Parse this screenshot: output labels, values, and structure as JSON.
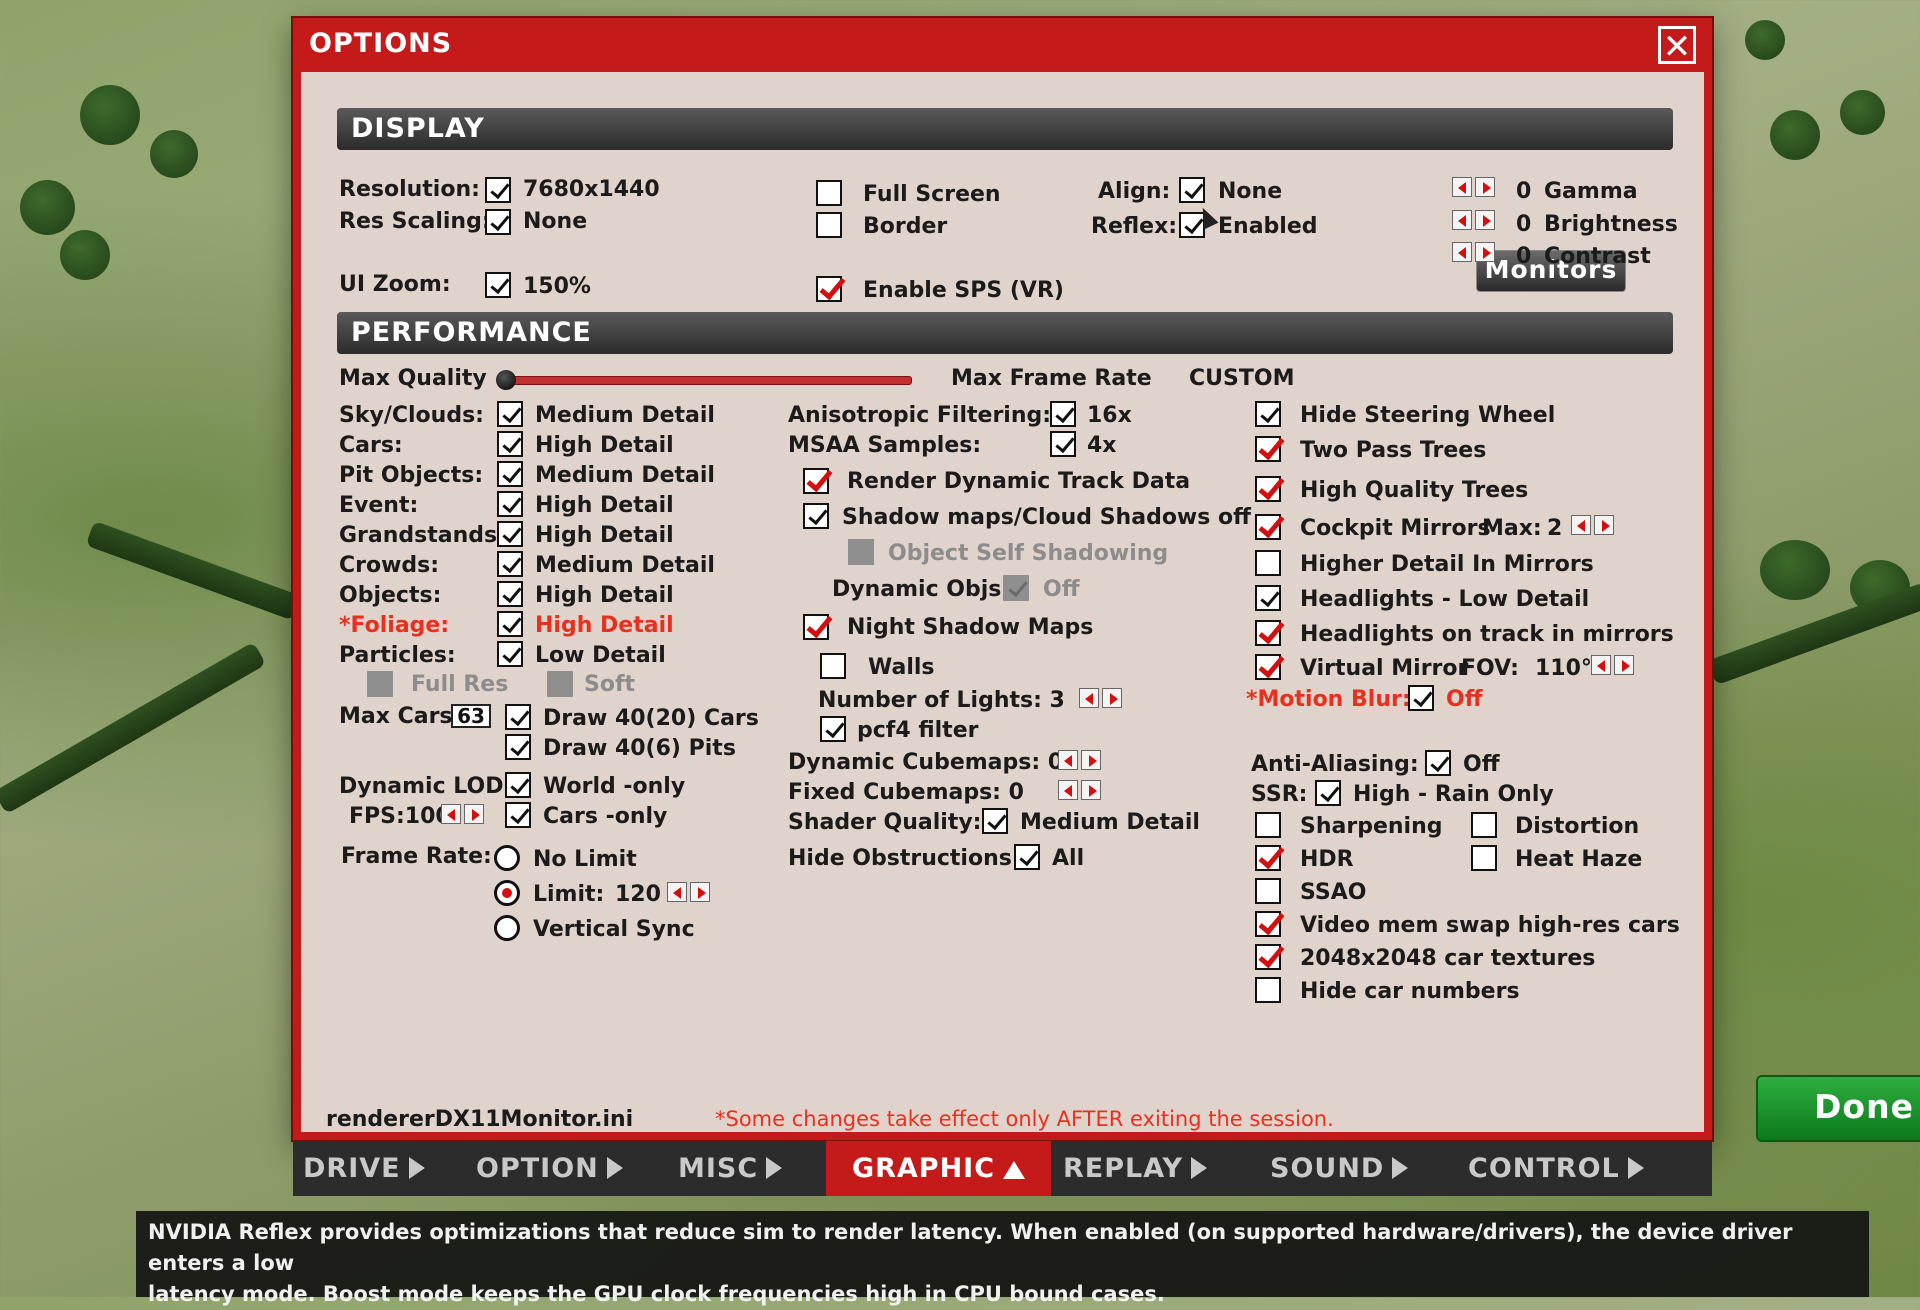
{
  "window": {
    "title": "OPTIONS",
    "close_icon": "close-icon"
  },
  "display": {
    "section_title": "DISPLAY",
    "resolution_label": "Resolution:",
    "resolution_value": "7680x1440",
    "res_scaling_label": "Res Scaling:",
    "res_scaling_value": "None",
    "ui_zoom_label": "UI Zoom:",
    "ui_zoom_value": "150%",
    "full_screen_label": "Full Screen",
    "full_screen": false,
    "border_label": "Border",
    "border": false,
    "sps_label": "Enable SPS (VR)",
    "sps": true,
    "align_label": "Align:",
    "align_value": "None",
    "reflex_label": "Reflex:",
    "reflex_value": "Enabled",
    "monitors_label": "Monitors",
    "gamma_value": "0",
    "gamma_label": "Gamma",
    "brightness_value": "0",
    "brightness_label": "Brightness",
    "contrast_value": "0",
    "contrast_label": "Contrast"
  },
  "performance": {
    "section_title": "PERFORMANCE",
    "max_quality_label": "Max Quality",
    "max_quality_level": 0.0,
    "max_frame_rate_label": "Max Frame Rate",
    "custom_label": "CUSTOM",
    "detail_rows": [
      {
        "label": "Sky/Clouds:",
        "value": "Medium Detail"
      },
      {
        "label": "Cars:",
        "value": "High Detail"
      },
      {
        "label": "Pit Objects:",
        "value": "Medium Detail"
      },
      {
        "label": "Event:",
        "value": "High Detail"
      },
      {
        "label": "Grandstands:",
        "value": "High Detail"
      },
      {
        "label": "Crowds:",
        "value": "Medium Detail"
      },
      {
        "label": "Objects:",
        "value": "High Detail"
      },
      {
        "label": "*Foliage:",
        "value": "High Detail"
      },
      {
        "label": "Particles:",
        "value": "Low Detail"
      }
    ],
    "full_res_label": "Full Res",
    "soft_label": "Soft",
    "max_cars_label": "Max Cars:",
    "max_cars_value": "63",
    "draw_cars_label": "Draw 40(20) Cars",
    "draw_pits_label": "Draw 40(6) Pits",
    "dynamic_lod_label": "Dynamic LOD",
    "fps_label": "FPS:100",
    "world_only_label": "World -only",
    "cars_only_label": "Cars -only",
    "frame_rate_label": "Frame Rate:",
    "no_limit_label": "No Limit",
    "limit_label": "Limit:",
    "limit_value": "120",
    "vsync_label": "Vertical Sync",
    "aniso_label": "Anisotropic Filtering:",
    "aniso_value": "16x",
    "msaa_label": "MSAA Samples:",
    "msaa_value": "4x",
    "render_dynamic_label": "Render Dynamic Track Data",
    "shadow_maps_label": "Shadow maps/Cloud Shadows off",
    "self_shadow_label": "Object Self Shadowing",
    "dynamic_objs_label": "Dynamic Objs:",
    "dynamic_objs_value": "Off",
    "night_shadow_label": "Night Shadow Maps",
    "walls_label": "Walls",
    "num_lights_label": "Number of Lights: 3",
    "pcf4_label": "pcf4 filter",
    "dyn_cubemaps_label": "Dynamic Cubemaps: 0",
    "fixed_cubemaps_label": "Fixed Cubemaps: 0",
    "shader_quality_label": "Shader Quality:",
    "shader_quality_value": "Medium Detail",
    "hide_obstructions_label": "Hide Obstructions:",
    "hide_obstructions_value": "All",
    "hide_steering_label": "Hide Steering Wheel",
    "two_pass_label": "Two Pass Trees",
    "hq_trees_label": "High Quality Trees",
    "cockpit_mirrors_label": "Cockpit Mirrors",
    "max_label": "Max:",
    "max_value": "2",
    "higher_detail_mirrors_label": "Higher Detail In Mirrors",
    "headlights_low_label": "Headlights - Low Detail",
    "headlights_track_label": "Headlights on track in mirrors",
    "virtual_mirror_label": "Virtual Mirror",
    "fov_label": "FOV:",
    "fov_value": "110°",
    "motion_blur_label": "*Motion Blur:",
    "motion_blur_value": "Off",
    "anti_aliasing_label": "Anti-Aliasing:",
    "anti_aliasing_value": "Off",
    "ssr_label": "SSR:",
    "ssr_value": "High - Rain Only",
    "sharpening_label": "Sharpening",
    "distortion_label": "Distortion",
    "hdr_label": "HDR",
    "heat_haze_label": "Heat Haze",
    "ssao_label": "SSAO",
    "video_mem_label": "Video mem swap high-res cars",
    "textures_label": "2048x2048 car textures",
    "hide_numbers_label": "Hide car numbers"
  },
  "footer": {
    "ini_file": "rendererDX11Monitor.ini",
    "note": "*Some changes take effect only AFTER exiting the session.",
    "done_label": "Done"
  },
  "tabs": [
    {
      "label": "DRIVE"
    },
    {
      "label": "OPTION"
    },
    {
      "label": "MISC"
    },
    {
      "label": "GRAPHIC"
    },
    {
      "label": "REPLAY"
    },
    {
      "label": "SOUND"
    },
    {
      "label": "CONTROL"
    }
  ],
  "tooltip": {
    "line1": "NVIDIA Reflex provides optimizations that reduce sim to render latency. When enabled (on supported hardware/drivers), the device driver enters a low",
    "line2": "latency mode.  Boost mode keeps the GPU clock frequencies high in CPU bound cases."
  },
  "colors": {
    "accent": "#c41a1a",
    "done_green": "#1e9a2e",
    "warning": "#e8301e"
  }
}
